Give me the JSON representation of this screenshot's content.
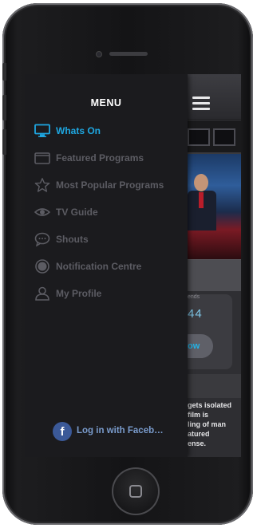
{
  "menu": {
    "title": "MENU",
    "items": [
      {
        "label": "Whats On",
        "icon": "tv-monitor-icon",
        "active": true
      },
      {
        "label": "Featured Programs",
        "icon": "folder-icon",
        "active": false
      },
      {
        "label": "Most Popular Programs",
        "icon": "star-icon",
        "active": false
      },
      {
        "label": "TV Guide",
        "icon": "eye-icon",
        "active": false
      },
      {
        "label": "Shouts",
        "icon": "chat-bubble-icon",
        "active": false
      },
      {
        "label": "Notification Centre",
        "icon": "circle-icon",
        "active": false
      },
      {
        "label": "My Profile",
        "icon": "user-icon",
        "active": false
      }
    ],
    "facebook": {
      "label": "Log in with Faceb…",
      "icon": "facebook-icon",
      "glyph": "f"
    }
  },
  "background_app": {
    "small_label": "ends",
    "number": "44",
    "button_label": "ow",
    "description": "gets isolated\nfilm is\nling of man\natured\nense."
  },
  "colors": {
    "accent": "#1ea7e1",
    "drawer_bg": "#1b1b1e",
    "inactive_text": "#5c5c63",
    "facebook": "#3b5998"
  }
}
